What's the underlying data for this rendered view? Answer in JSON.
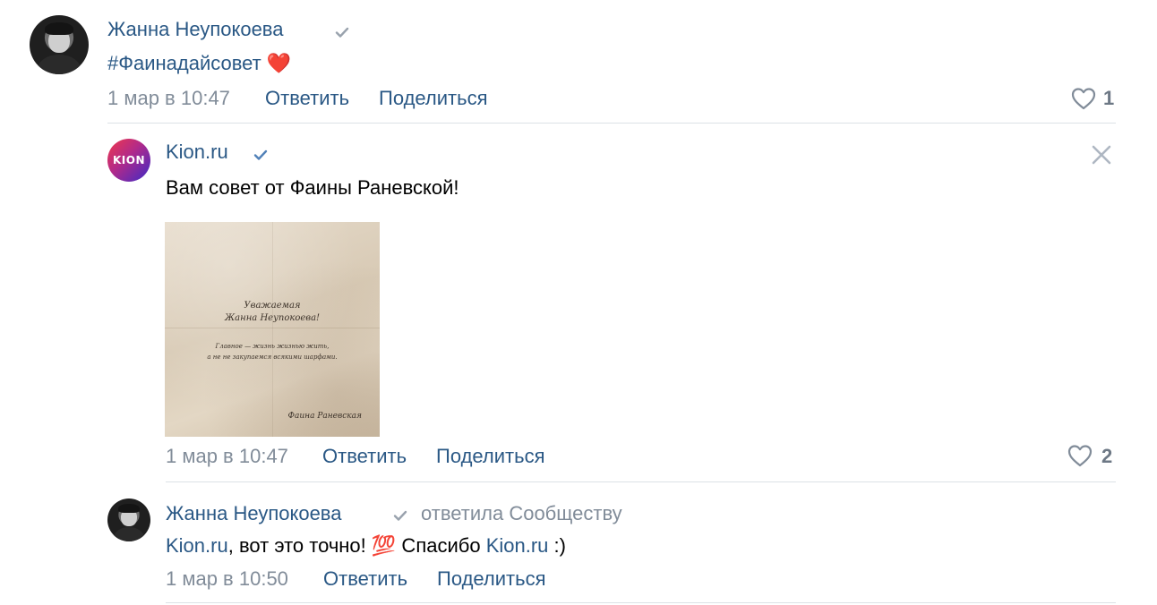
{
  "comments": [
    {
      "author": "Жанна Неупокоева",
      "text_hashtag": "#Фаинадайсовет",
      "text_emoji": "❤️",
      "date": "1 мар в 10:47",
      "reply_label": "Ответить",
      "share_label": "Поделиться",
      "likes": "1"
    },
    {
      "author": "Kion.ru",
      "avatar_text": "KION",
      "text": "Вам совет от Фаины Раневской!",
      "attachment": {
        "line1": "Уважаемая",
        "line2": "Жанна Неупокоева!",
        "line3": "Главное — жизнь жизнью жить,",
        "line4": "а не не закупаемся всякими шарфами.",
        "signature": "Фаина Раневская"
      },
      "date": "1 мар в 10:47",
      "reply_label": "Ответить",
      "share_label": "Поделиться",
      "likes": "2"
    },
    {
      "author": "Жанна Неупокоева",
      "reply_note": "ответила Сообществу",
      "mention1": "Kion.ru",
      "text_mid": ", вот это точно! ",
      "emoji": "💯",
      "text_thanks": " Спасибо ",
      "mention2": "Kion.ru",
      "text_end": " :)",
      "date": "1 мар в 10:50",
      "reply_label": "Ответить",
      "share_label": "Поделиться"
    }
  ],
  "colors": {
    "link": "#2a5885",
    "secondary": "#818c99",
    "verified_blue": "#5181b8",
    "verified_gray": "#99a2ad",
    "divider": "#dce1e6"
  }
}
